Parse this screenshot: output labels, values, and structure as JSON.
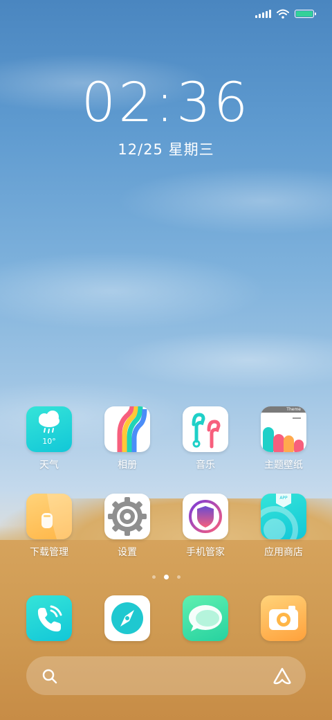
{
  "status_bar": {
    "battery_level": 1.0,
    "battery_color": "#33d199"
  },
  "lock": {
    "time": "02:36",
    "date": "12/25 星期三"
  },
  "apps": [
    {
      "label": "天气",
      "icon": "weather-icon",
      "temp": "10°"
    },
    {
      "label": "相册",
      "icon": "gallery-icon"
    },
    {
      "label": "音乐",
      "icon": "music-icon"
    },
    {
      "label": "主题壁纸",
      "icon": "theme-icon",
      "badge": "Theme"
    },
    {
      "label": "下载管理",
      "icon": "download-icon"
    },
    {
      "label": "设置",
      "icon": "settings-icon"
    },
    {
      "label": "手机管家",
      "icon": "security-icon"
    },
    {
      "label": "应用商店",
      "icon": "app-store-icon",
      "badge": "APP"
    }
  ],
  "dock": [
    {
      "icon": "phone-icon"
    },
    {
      "icon": "browser-icon"
    },
    {
      "icon": "messages-icon"
    },
    {
      "icon": "camera-icon"
    }
  ],
  "pager": {
    "pages": 3,
    "active": 2
  },
  "search": {
    "icon": "search-icon",
    "assistant_icon": "assistant-icon"
  }
}
